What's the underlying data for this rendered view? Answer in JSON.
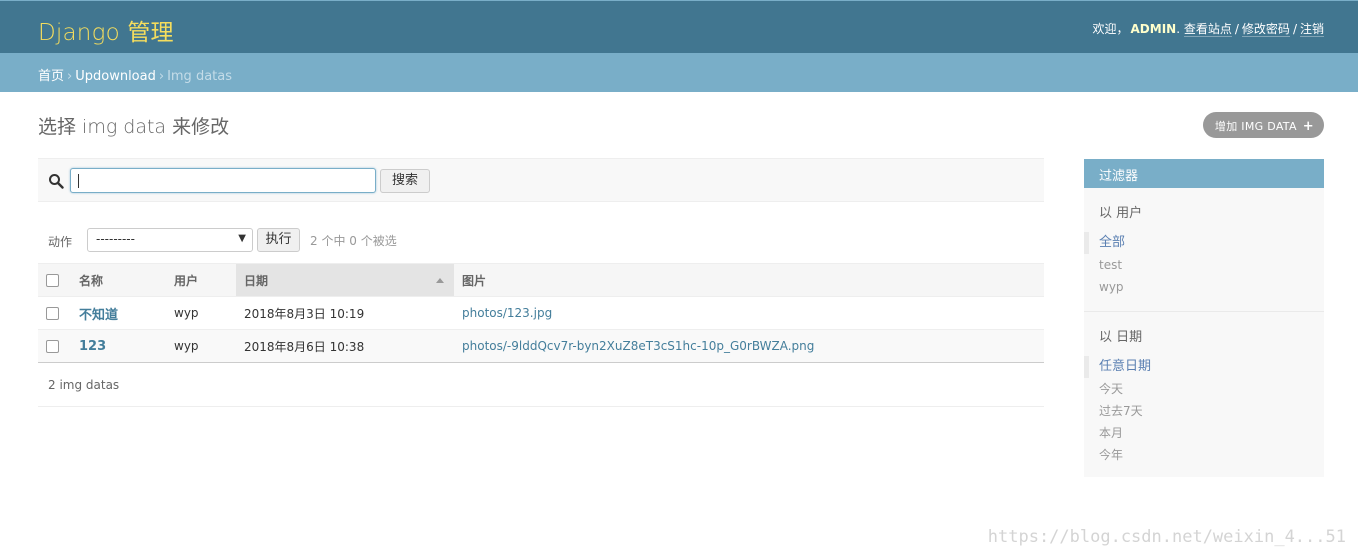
{
  "header": {
    "branding": "Django 管理",
    "welcome": "欢迎，",
    "username": "ADMIN",
    "links": [
      "查看站点",
      "修改密码",
      "注销"
    ],
    "accent": "#f5dd5d",
    "bg": "#417690"
  },
  "breadcrumbs": {
    "items": [
      "首页",
      "Updownload",
      "Img datas"
    ]
  },
  "content": {
    "title": "选择 img data 来修改",
    "add_label": "增加 IMG DATA"
  },
  "search": {
    "value": "",
    "button_label": "搜索"
  },
  "actions": {
    "label": "动作",
    "selected": "---------",
    "go_label": "执行",
    "counter": "2 个中 0 个被选"
  },
  "table": {
    "columns": [
      "名称",
      "用户",
      "日期",
      "图片"
    ],
    "rows": [
      {
        "name": "不知道",
        "user": "wyp",
        "date": "2018年8月3日 10:19",
        "image": "photos/123.jpg"
      },
      {
        "name": "123",
        "user": "wyp",
        "date": "2018年8月6日 10:38",
        "image": "photos/-9lddQcv7r-byn2XuZ8eT3cS1hc-10p_G0rBWZA.png"
      }
    ],
    "paginator": "2 img datas"
  },
  "filter": {
    "title": "过滤器",
    "groups": [
      {
        "heading": "以 用户",
        "options": [
          "全部",
          "test",
          "wyp"
        ],
        "selected": "全部"
      },
      {
        "heading": "以 日期",
        "options": [
          "任意日期",
          "今天",
          "过去7天",
          "本月",
          "今年"
        ],
        "selected": "任意日期"
      }
    ]
  },
  "watermark": "https://blog.csdn.net/weixin_4...51"
}
